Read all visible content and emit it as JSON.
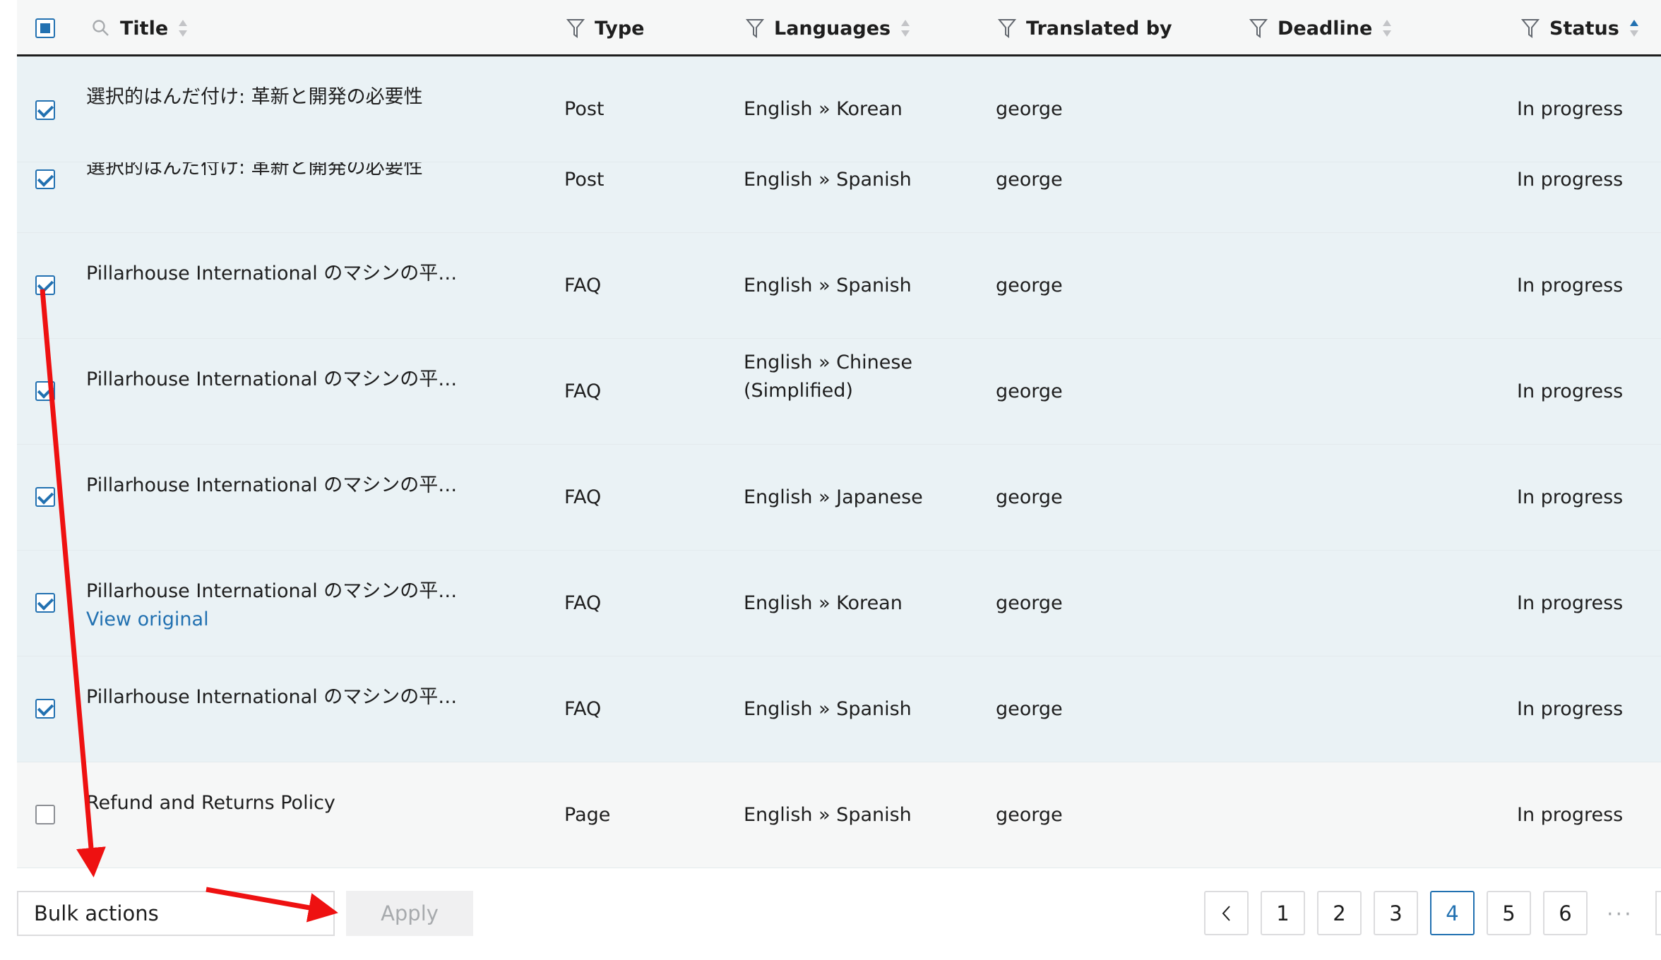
{
  "header": {
    "title": "Title",
    "type": "Type",
    "languages": "Languages",
    "translated_by": "Translated by",
    "deadline": "Deadline",
    "status": "Status"
  },
  "rows": [
    {
      "title": "選択的はんだ付け: 革新と開発の必要性",
      "type": "Post",
      "languages": "English » Korean",
      "translated_by": "george",
      "deadline": "",
      "status": "In progress",
      "checked": true
    },
    {
      "title": "選択的はんだ付け: 革新と開発の必要性",
      "type": "Post",
      "languages": "English » Spanish",
      "translated_by": "george",
      "deadline": "",
      "status": "In progress",
      "checked": true
    },
    {
      "title": "Pillarhouse International のマシンの平…",
      "type": "FAQ",
      "languages": "English » Spanish",
      "translated_by": "george",
      "deadline": "",
      "status": "In progress",
      "checked": true
    },
    {
      "title": "Pillarhouse International のマシンの平…",
      "type": "FAQ",
      "languages": "English » Chinese (Simplified)",
      "translated_by": "george",
      "deadline": "",
      "status": "In progress",
      "checked": true
    },
    {
      "title": "Pillarhouse International のマシンの平…",
      "type": "FAQ",
      "languages": "English » Japanese",
      "translated_by": "george",
      "deadline": "",
      "status": "In progress",
      "checked": true
    },
    {
      "title": "Pillarhouse International のマシンの平…",
      "type": "FAQ",
      "languages": "English » Korean",
      "translated_by": "george",
      "deadline": "",
      "status": "In progress",
      "checked": true,
      "link": "View original"
    },
    {
      "title": "Pillarhouse International のマシンの平…",
      "type": "FAQ",
      "languages": "English » Spanish",
      "translated_by": "george",
      "deadline": "",
      "status": "In progress",
      "checked": true
    },
    {
      "title": "Refund and Returns Policy",
      "type": "Page",
      "languages": "English » Spanish",
      "translated_by": "george",
      "deadline": "",
      "status": "In progress",
      "checked": false
    }
  ],
  "footer": {
    "bulk_actions": "Bulk actions",
    "apply": "Apply",
    "pages": [
      "1",
      "2",
      "3",
      "4",
      "5",
      "6"
    ],
    "current_page": "4",
    "ellipsis": "···"
  },
  "colors": {
    "accent": "#2271b1",
    "annotation_arrow": "#ee1111",
    "selected_row_bg": "#eaf2f5"
  }
}
